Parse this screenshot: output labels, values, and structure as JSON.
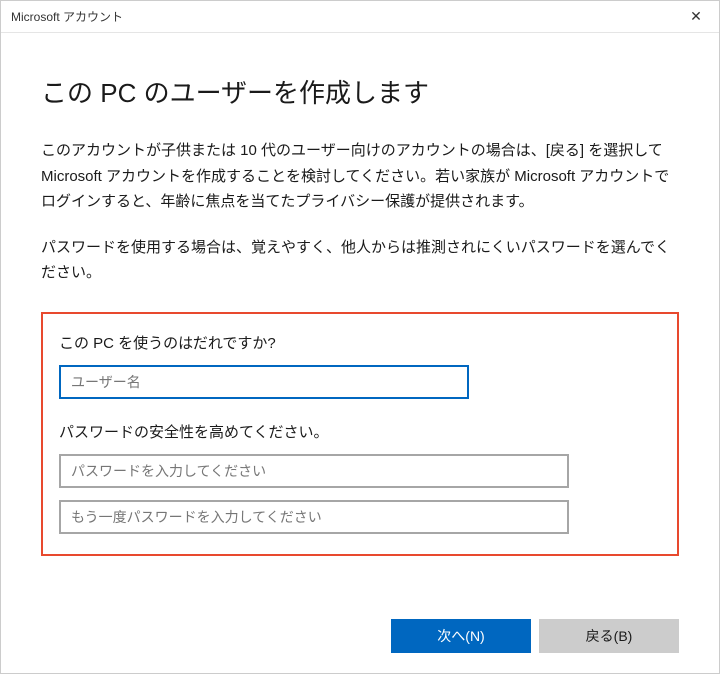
{
  "window": {
    "title": "Microsoft アカウント"
  },
  "heading": "この PC のユーザーを作成します",
  "paragraphs": {
    "p1": "このアカウントが子供または 10 代のユーザー向けのアカウントの場合は、[戻る] を選択して Microsoft アカウントを作成することを検討してください。若い家族が Microsoft アカウントでログインすると、年齢に焦点を当てたプライバシー保護が提供されます。",
    "p2": "パスワードを使用する場合は、覚えやすく、他人からは推測されにくいパスワードを選んでください。"
  },
  "form": {
    "who_label": "この PC を使うのはだれですか?",
    "username_placeholder": "ユーザー名",
    "password_label": "パスワードの安全性を高めてください。",
    "password_placeholder": "パスワードを入力してください",
    "password_confirm_placeholder": "もう一度パスワードを入力してください"
  },
  "buttons": {
    "next": "次へ(N)",
    "back": "戻る(B)"
  }
}
